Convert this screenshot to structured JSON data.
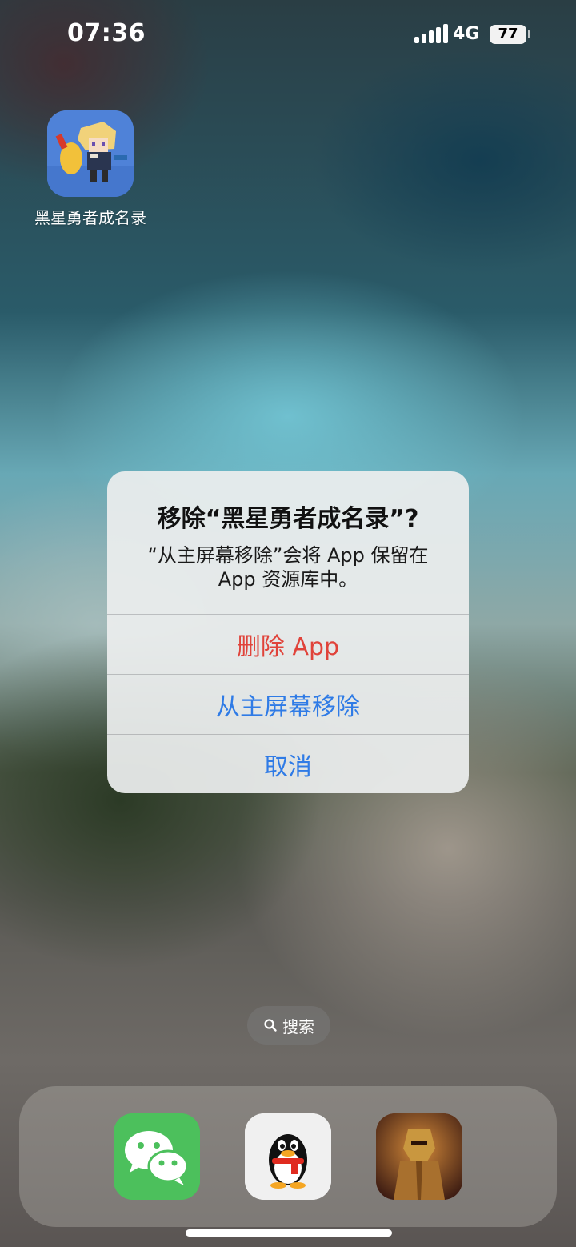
{
  "status_bar": {
    "time": "07:36",
    "network": "4G",
    "battery": "77"
  },
  "home": {
    "app": {
      "label": "黑星勇者成名录",
      "icon": "pixel-hero-game-icon"
    }
  },
  "alert": {
    "title": "移除“黑星勇者成名录”?",
    "message_line1": "“从主屏幕移除”会将 App 保留在",
    "message_line2": "App 资源库中。",
    "buttons": [
      {
        "label": "删除 App",
        "color": "#e0433a"
      },
      {
        "label": "从主屏幕移除",
        "color": "#2f7be6"
      },
      {
        "label": "取消",
        "color": "#2f7be6"
      }
    ]
  },
  "search": {
    "label": "搜索",
    "icon": "search-icon"
  },
  "dock": {
    "apps": [
      {
        "name": "wechat",
        "icon": "wechat-icon",
        "color": "#4cc05c"
      },
      {
        "name": "qq",
        "icon": "qq-penguin-icon",
        "color": "#f0f0f0"
      },
      {
        "name": "game",
        "icon": "armored-knight-game-icon",
        "color": "#7a3a22"
      }
    ]
  }
}
